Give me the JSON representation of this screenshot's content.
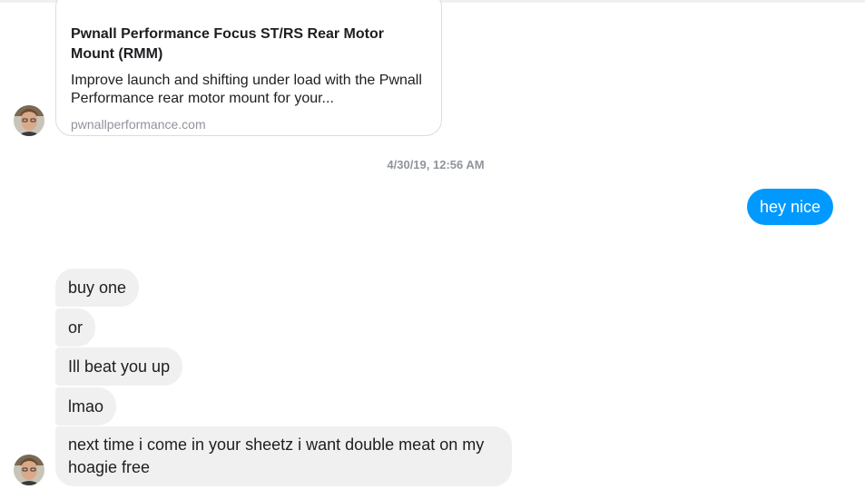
{
  "link_preview": {
    "title": "Pwnall Performance Focus ST/RS Rear Motor Mount (RMM)",
    "description": "Improve launch and shifting under load with the Pwnall Performance rear motor mount for your...",
    "domain": "pwnallperformance.com"
  },
  "timestamp": "4/30/19, 12:56 AM",
  "messages": [
    {
      "direction": "outgoing",
      "text": "hey nice"
    },
    {
      "direction": "incoming",
      "text": "buy one"
    },
    {
      "direction": "incoming",
      "text": "or"
    },
    {
      "direction": "incoming",
      "text": "Ill beat you up"
    },
    {
      "direction": "incoming",
      "text": "lmao"
    },
    {
      "direction": "incoming",
      "text": "next time i come in your sheetz i want double meat on my hoagie free"
    }
  ],
  "colors": {
    "outgoing_bubble": "#0099ff",
    "incoming_bubble": "#f1f0f0",
    "timestamp_text": "#90949c"
  }
}
